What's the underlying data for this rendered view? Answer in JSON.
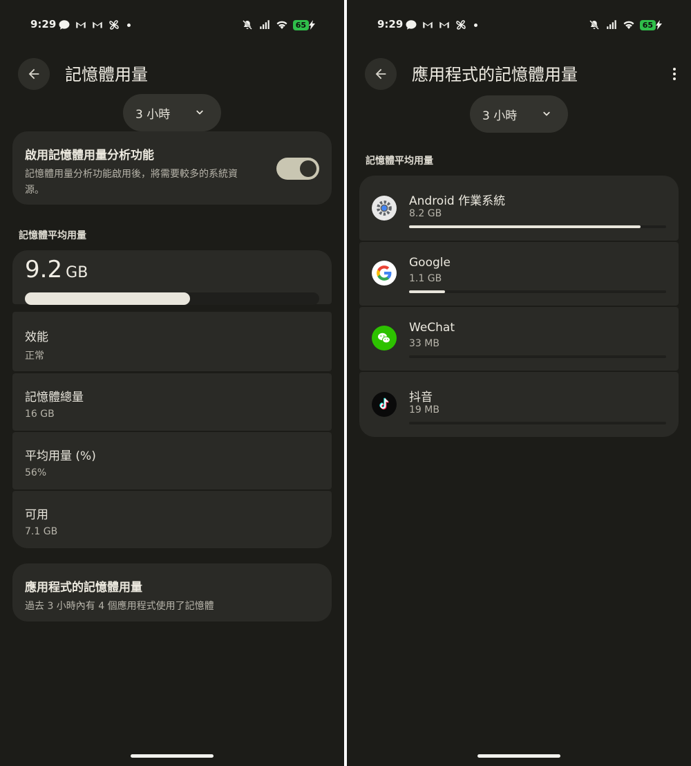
{
  "status_bar": {
    "time": "9:29",
    "battery": "65"
  },
  "left": {
    "title": "記憶體用量",
    "duration": "3 小時",
    "toggle_card": {
      "title": "啟用記憶體用量分析功能",
      "desc": "記憶體用量分析功能啟用後，將需要較多的系統資源。",
      "enabled": true
    },
    "avg_section_label": "記憶體平均用量",
    "avg_value": "9.2",
    "avg_unit": "GB",
    "avg_fraction": 0.56,
    "stats": [
      {
        "title": "效能",
        "value": "正常"
      },
      {
        "title": "記憶體總量",
        "value": "16 GB"
      },
      {
        "title": "平均用量 (%)",
        "value": "56%"
      },
      {
        "title": "可用",
        "value": "7.1 GB"
      }
    ],
    "apps_link": {
      "title": "應用程式的記憶體用量",
      "desc": "過去 3 小時內有 4 個應用程式使用了記憶體"
    }
  },
  "right": {
    "title": "應用程式的記憶體用量",
    "duration": "3 小時",
    "section_label": "記憶體平均用量",
    "apps": [
      {
        "name": "Android 作業系統",
        "size": "8.2 GB",
        "fraction": 0.9,
        "icon": "android-os-icon"
      },
      {
        "name": "Google",
        "size": "1.1 GB",
        "fraction": 0.14,
        "icon": "google-icon"
      },
      {
        "name": "WeChat",
        "size": "33 MB",
        "fraction": 0.0,
        "icon": "wechat-icon"
      },
      {
        "name": "抖音",
        "size": "19 MB",
        "fraction": 0.0,
        "icon": "douyin-icon"
      }
    ]
  }
}
